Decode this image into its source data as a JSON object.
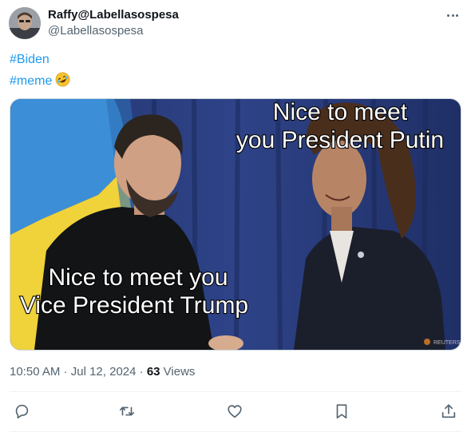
{
  "author": {
    "display_name": "Raffy@Labellasospesa",
    "handle": "@Labellasospesa"
  },
  "tweet": {
    "hashtags": [
      "#Biden",
      "#meme"
    ],
    "emoji": "rolling-on-floor-laughing",
    "media": {
      "caption_top_line1": "Nice to meet",
      "caption_top_line2": "you President Putin",
      "caption_bottom_line1": "Nice to meet you",
      "caption_bottom_line2": "Vice President Trump",
      "watermark": "REUTERS"
    }
  },
  "meta": {
    "time": "10:50 AM",
    "separator": "·",
    "date": "Jul 12, 2024",
    "views_count": "63",
    "views_label": "Views"
  },
  "icons": {
    "reply": "reply-icon",
    "retweet": "retweet-icon",
    "like": "like-icon",
    "bookmark": "bookmark-icon",
    "share": "share-icon",
    "more": "more-icon"
  },
  "colors": {
    "link": "#1d9bf0",
    "secondary_text": "#536471",
    "primary_text": "#0f1419"
  }
}
